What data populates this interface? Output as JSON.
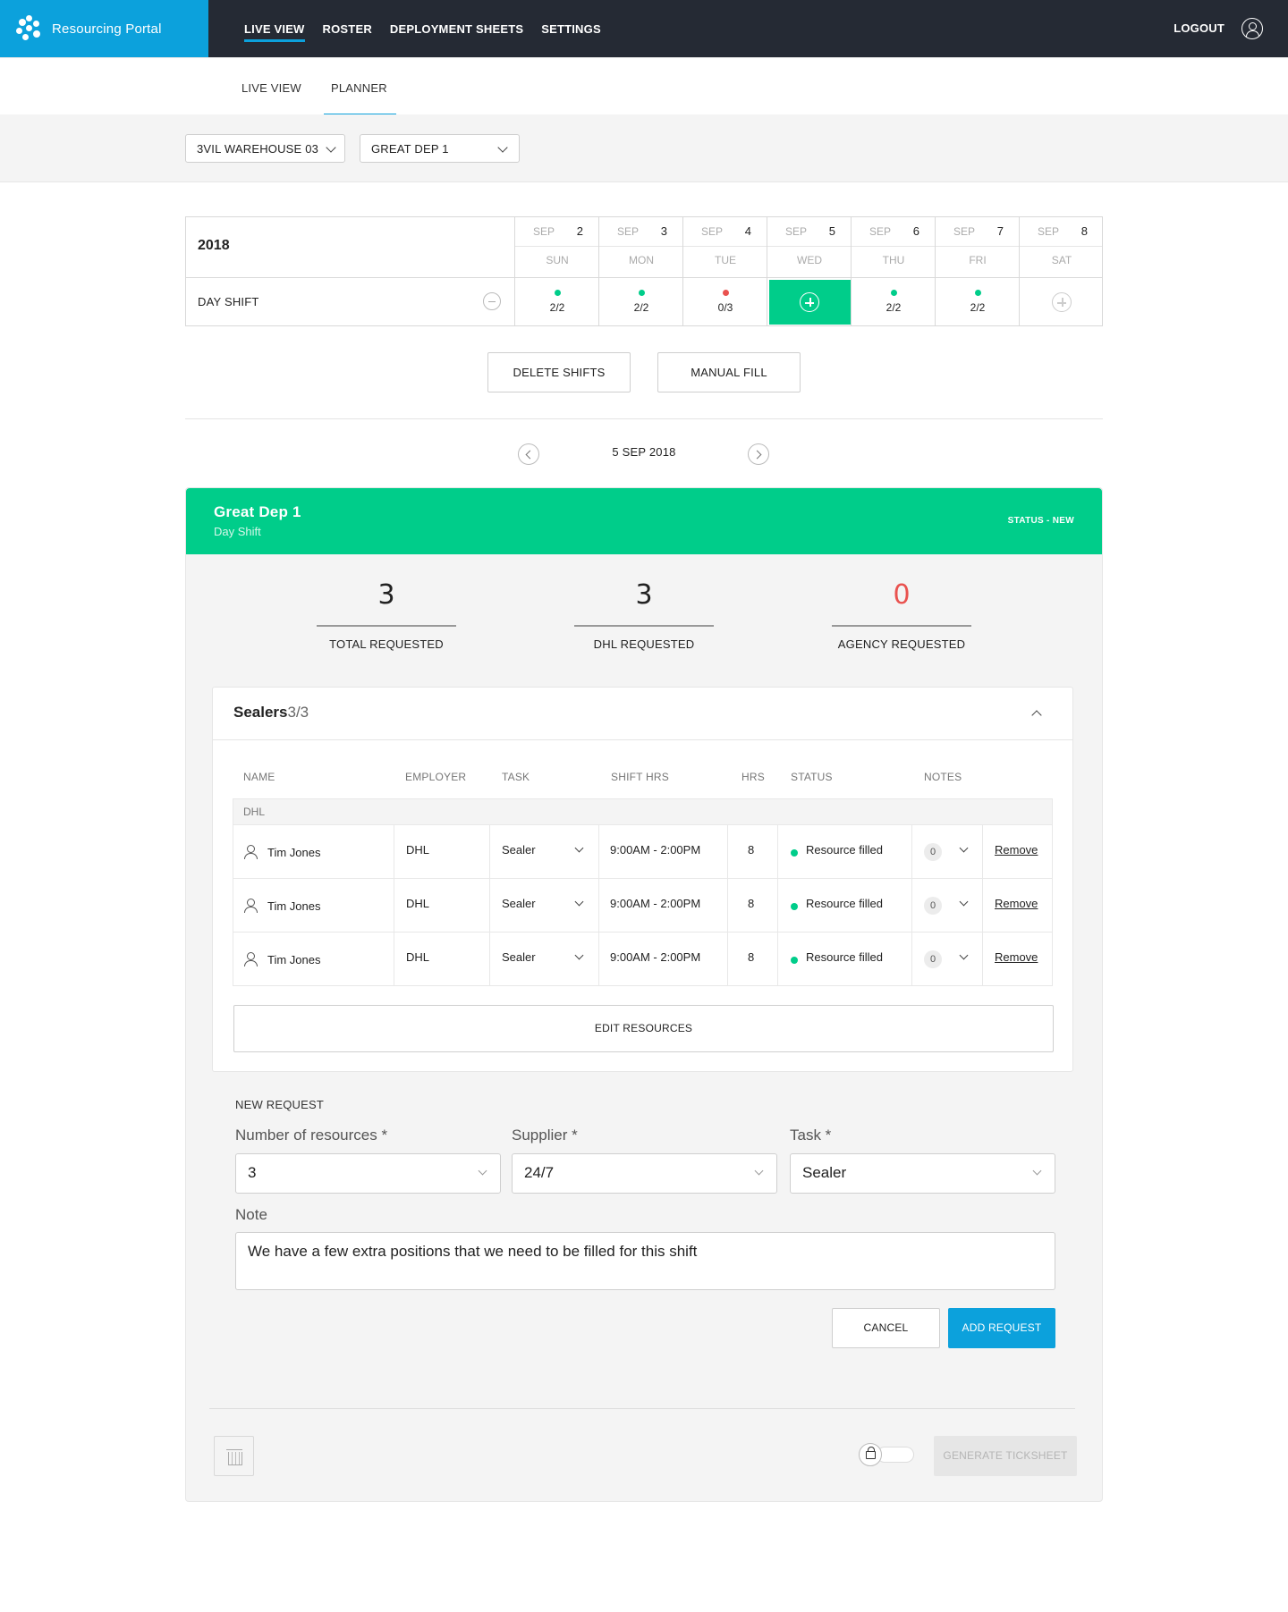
{
  "app": {
    "name": "Resourcing Portal"
  },
  "nav": {
    "items": [
      "LIVE VIEW",
      "ROSTER",
      "DEPLOYMENT SHEETS",
      "SETTINGS"
    ],
    "active": "LIVE VIEW",
    "logout": "LOGOUT"
  },
  "subnav": {
    "items": [
      "LIVE VIEW",
      "PLANNER"
    ],
    "active": "PLANNER"
  },
  "filters": {
    "warehouse": "3VIL WAREHOUSE 03",
    "department": "GREAT DEP 1"
  },
  "week": {
    "year": "2018",
    "days": [
      {
        "month": "SEP",
        "num": "2",
        "dow": "SUN",
        "count": "2/2",
        "status": "green"
      },
      {
        "month": "SEP",
        "num": "3",
        "dow": "MON",
        "count": "2/2",
        "status": "green"
      },
      {
        "month": "SEP",
        "num": "4",
        "dow": "TUE",
        "count": "0/3",
        "status": "red"
      },
      {
        "month": "SEP",
        "num": "5",
        "dow": "WED",
        "count": "",
        "status": "selected"
      },
      {
        "month": "SEP",
        "num": "6",
        "dow": "THU",
        "count": "2/2",
        "status": "green"
      },
      {
        "month": "SEP",
        "num": "7",
        "dow": "FRI",
        "count": "2/2",
        "status": "green"
      },
      {
        "month": "SEP",
        "num": "8",
        "dow": "SAT",
        "count": "",
        "status": "empty"
      }
    ],
    "shift_label": "DAY SHIFT"
  },
  "actions": {
    "delete_shifts": "DELETE SHIFTS",
    "manual_fill": "MANUAL FILL"
  },
  "date_nav": {
    "date": "5 SEP 2018"
  },
  "card": {
    "title": "Great Dep 1",
    "subtitle": "Day Shift",
    "status": "STATUS - NEW",
    "stats": [
      {
        "value": "3",
        "label": "TOTAL REQUESTED"
      },
      {
        "value": "3",
        "label": "DHL REQUESTED"
      },
      {
        "value": "0",
        "label": "AGENCY REQUESTED"
      }
    ]
  },
  "sealers": {
    "title": "Sealers",
    "count": "3/3",
    "columns": [
      "NAME",
      "EMPLOYER",
      "TASK",
      "SHIFT HRS",
      "HRS",
      "STATUS",
      "NOTES"
    ],
    "group": "DHL",
    "rows": [
      {
        "name": "Tim Jones",
        "employer": "DHL",
        "task": "Sealer",
        "shift": "9:00AM - 2:00PM",
        "hrs": "8",
        "status": "Resource filled",
        "notes": "0",
        "action": "Remove"
      },
      {
        "name": "Tim Jones",
        "employer": "DHL",
        "task": "Sealer",
        "shift": "9:00AM - 2:00PM",
        "hrs": "8",
        "status": "Resource filled",
        "notes": "0",
        "action": "Remove"
      },
      {
        "name": "Tim Jones",
        "employer": "DHL",
        "task": "Sealer",
        "shift": "9:00AM - 2:00PM",
        "hrs": "8",
        "status": "Resource filled",
        "notes": "0",
        "action": "Remove"
      }
    ],
    "edit_button": "EDIT RESOURCES"
  },
  "new_request": {
    "title": "NEW REQUEST",
    "resources_label": "Number of resources *",
    "resources_value": "3",
    "supplier_label": "Supplier *",
    "supplier_value": "24/7",
    "task_label": "Task *",
    "task_value": "Sealer",
    "note_label": "Note",
    "note_value": "We have a few extra positions that we need to be filled for this shift",
    "cancel": "CANCEL",
    "add": "ADD REQUEST"
  },
  "footer": {
    "generate": "GENERATE TICKSHEET"
  },
  "colors": {
    "brand": "#0ca1dc",
    "topbar": "#252a34",
    "green": "#00cd8a",
    "red": "#e9524f"
  }
}
